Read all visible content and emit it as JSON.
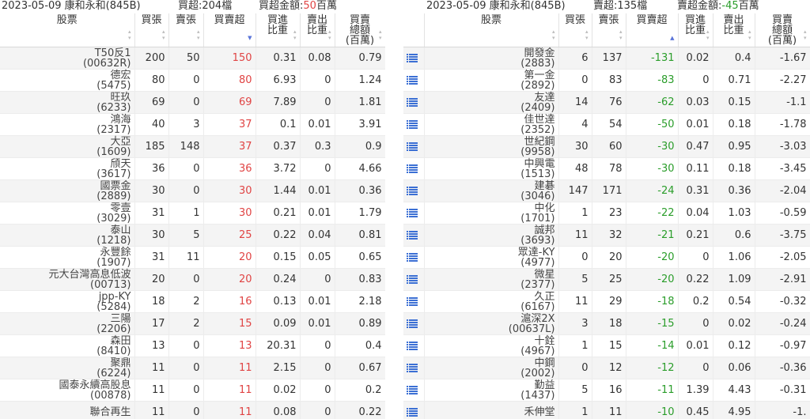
{
  "left": {
    "title_date_broker": "2023-05-09 康和永和(845B)",
    "count_label": "買超:204檔",
    "amount_label": "買超金額:",
    "amount_value": "50",
    "amount_unit": "百萬",
    "headers": [
      "股票",
      "買張",
      "賣張",
      "買賣超",
      "買進\n比重",
      "賣出\n比重",
      "買賣\n總額\n(百萬)"
    ],
    "rows": [
      {
        "name": "T50反1",
        "code": "(00632R)",
        "buy": "200",
        "sell": "50",
        "net": "150",
        "buy_pct": "0.31",
        "sell_pct": "0.08",
        "total": "0.79"
      },
      {
        "name": "德宏",
        "code": "(5475)",
        "buy": "80",
        "sell": "0",
        "net": "80",
        "buy_pct": "6.93",
        "sell_pct": "0",
        "total": "1.24"
      },
      {
        "name": "旺玖",
        "code": "(6233)",
        "buy": "69",
        "sell": "0",
        "net": "69",
        "buy_pct": "7.89",
        "sell_pct": "0",
        "total": "1.81"
      },
      {
        "name": "鴻海",
        "code": "(2317)",
        "buy": "40",
        "sell": "3",
        "net": "37",
        "buy_pct": "0.1",
        "sell_pct": "0.01",
        "total": "3.91"
      },
      {
        "name": "大亞",
        "code": "(1609)",
        "buy": "185",
        "sell": "148",
        "net": "37",
        "buy_pct": "0.37",
        "sell_pct": "0.3",
        "total": "0.9"
      },
      {
        "name": "頎天",
        "code": "(3617)",
        "buy": "36",
        "sell": "0",
        "net": "36",
        "buy_pct": "3.72",
        "sell_pct": "0",
        "total": "4.66"
      },
      {
        "name": "國票金",
        "code": "(2889)",
        "buy": "30",
        "sell": "0",
        "net": "30",
        "buy_pct": "1.44",
        "sell_pct": "0.01",
        "total": "0.36"
      },
      {
        "name": "零壹",
        "code": "(3029)",
        "buy": "31",
        "sell": "1",
        "net": "30",
        "buy_pct": "0.21",
        "sell_pct": "0.01",
        "total": "1.79"
      },
      {
        "name": "泰山",
        "code": "(1218)",
        "buy": "30",
        "sell": "5",
        "net": "25",
        "buy_pct": "0.22",
        "sell_pct": "0.04",
        "total": "0.81"
      },
      {
        "name": "永豐餘",
        "code": "(1907)",
        "buy": "31",
        "sell": "11",
        "net": "20",
        "buy_pct": "0.15",
        "sell_pct": "0.05",
        "total": "0.65"
      },
      {
        "name": "元大台灣高息低波",
        "code": "(00713)",
        "buy": "20",
        "sell": "0",
        "net": "20",
        "buy_pct": "0.24",
        "sell_pct": "0",
        "total": "0.83"
      },
      {
        "name": "jpp-KY",
        "code": "(5284)",
        "buy": "18",
        "sell": "2",
        "net": "16",
        "buy_pct": "0.13",
        "sell_pct": "0.01",
        "total": "2.18"
      },
      {
        "name": "三陽",
        "code": "(2206)",
        "buy": "17",
        "sell": "2",
        "net": "15",
        "buy_pct": "0.09",
        "sell_pct": "0.01",
        "total": "0.89"
      },
      {
        "name": "森田",
        "code": "(8410)",
        "buy": "13",
        "sell": "0",
        "net": "13",
        "buy_pct": "20.31",
        "sell_pct": "0",
        "total": "0.4"
      },
      {
        "name": "聚鼎",
        "code": "(6224)",
        "buy": "11",
        "sell": "0",
        "net": "11",
        "buy_pct": "2.15",
        "sell_pct": "0",
        "total": "0.67"
      },
      {
        "name": "國泰永續高股息",
        "code": "(00878)",
        "buy": "11",
        "sell": "0",
        "net": "11",
        "buy_pct": "0.02",
        "sell_pct": "0",
        "total": "0.2"
      },
      {
        "name": "聯合再生",
        "code": "",
        "buy": "11",
        "sell": "0",
        "net": "11",
        "buy_pct": "0.08",
        "sell_pct": "0",
        "total": "0.22"
      }
    ]
  },
  "right": {
    "title_date_broker": "2023-05-09 康和永和(845B)",
    "count_label": "賣超:135檔",
    "amount_label": "賣超金額:",
    "amount_value": "-45",
    "amount_unit": "百萬",
    "headers": [
      "股票",
      "買張",
      "賣張",
      "買賣超",
      "買進\n比重",
      "賣出\n比重",
      "買賣\n總額\n(百萬)"
    ],
    "rows": [
      {
        "name": "開發金",
        "code": "(2883)",
        "buy": "6",
        "sell": "137",
        "net": "-131",
        "buy_pct": "0.02",
        "sell_pct": "0.4",
        "total": "-1.67"
      },
      {
        "name": "第一金",
        "code": "(2892)",
        "buy": "0",
        "sell": "83",
        "net": "-83",
        "buy_pct": "0",
        "sell_pct": "0.71",
        "total": "-2.27"
      },
      {
        "name": "友達",
        "code": "(2409)",
        "buy": "14",
        "sell": "76",
        "net": "-62",
        "buy_pct": "0.03",
        "sell_pct": "0.15",
        "total": "-1.1"
      },
      {
        "name": "佳世達",
        "code": "(2352)",
        "buy": "4",
        "sell": "54",
        "net": "-50",
        "buy_pct": "0.01",
        "sell_pct": "0.18",
        "total": "-1.78"
      },
      {
        "name": "世紀鋼",
        "code": "(9958)",
        "buy": "30",
        "sell": "60",
        "net": "-30",
        "buy_pct": "0.47",
        "sell_pct": "0.95",
        "total": "-3.03"
      },
      {
        "name": "中興電",
        "code": "(1513)",
        "buy": "48",
        "sell": "78",
        "net": "-30",
        "buy_pct": "0.11",
        "sell_pct": "0.18",
        "total": "-3.45"
      },
      {
        "name": "建碁",
        "code": "(3046)",
        "buy": "147",
        "sell": "171",
        "net": "-24",
        "buy_pct": "0.31",
        "sell_pct": "0.36",
        "total": "-2.04"
      },
      {
        "name": "中化",
        "code": "(1701)",
        "buy": "1",
        "sell": "23",
        "net": "-22",
        "buy_pct": "0.04",
        "sell_pct": "1.03",
        "total": "-0.59"
      },
      {
        "name": "誠邦",
        "code": "(3693)",
        "buy": "11",
        "sell": "32",
        "net": "-21",
        "buy_pct": "0.21",
        "sell_pct": "0.6",
        "total": "-3.75"
      },
      {
        "name": "眾達-KY",
        "code": "(4977)",
        "buy": "0",
        "sell": "20",
        "net": "-20",
        "buy_pct": "0",
        "sell_pct": "1.06",
        "total": "-2.05"
      },
      {
        "name": "微星",
        "code": "(2377)",
        "buy": "5",
        "sell": "25",
        "net": "-20",
        "buy_pct": "0.22",
        "sell_pct": "1.09",
        "total": "-2.91"
      },
      {
        "name": "久正",
        "code": "(6167)",
        "buy": "11",
        "sell": "29",
        "net": "-18",
        "buy_pct": "0.2",
        "sell_pct": "0.54",
        "total": "-0.32"
      },
      {
        "name": "滬深2X",
        "code": "(00637L)",
        "buy": "3",
        "sell": "18",
        "net": "-15",
        "buy_pct": "0",
        "sell_pct": "0.02",
        "total": "-0.24"
      },
      {
        "name": "十銓",
        "code": "(4967)",
        "buy": "1",
        "sell": "15",
        "net": "-14",
        "buy_pct": "0.01",
        "sell_pct": "0.12",
        "total": "-0.97"
      },
      {
        "name": "中鋼",
        "code": "(2002)",
        "buy": "0",
        "sell": "12",
        "net": "-12",
        "buy_pct": "0",
        "sell_pct": "0.06",
        "total": "-0.36"
      },
      {
        "name": "勤益",
        "code": "(1437)",
        "buy": "5",
        "sell": "16",
        "net": "-11",
        "buy_pct": "1.39",
        "sell_pct": "4.43",
        "total": "-0.31"
      },
      {
        "name": "禾伸堂",
        "code": "",
        "buy": "1",
        "sell": "11",
        "net": "-10",
        "buy_pct": "0.45",
        "sell_pct": "4.95",
        "total": "-1."
      }
    ]
  },
  "icons": {
    "row_detail": "list-icon"
  },
  "colors": {
    "positive": "#e04444",
    "negative": "#2a9d2a",
    "icon": "#3b6fd4"
  }
}
